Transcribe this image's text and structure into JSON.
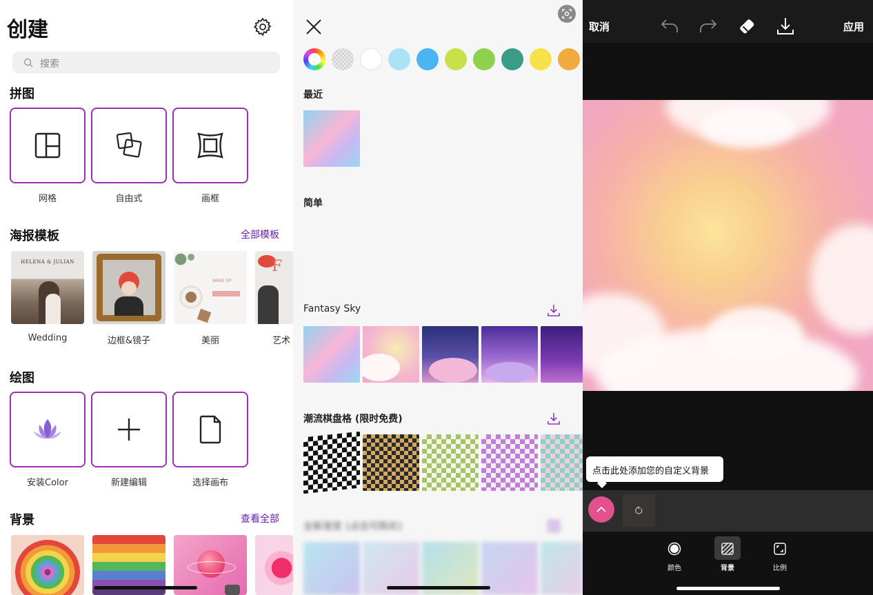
{
  "create": {
    "title": "创建",
    "search_placeholder": "搜索",
    "collage": {
      "heading": "拼图",
      "items": [
        {
          "label": "网格"
        },
        {
          "label": "自由式"
        },
        {
          "label": "画框"
        }
      ]
    },
    "poster": {
      "heading": "海报模板",
      "link": "全部模板",
      "items": [
        {
          "label": "Wedding"
        },
        {
          "label": "边框&镜子"
        },
        {
          "label": "美丽"
        },
        {
          "label": "艺术"
        }
      ],
      "wedding_caption": "HELENA & JULIAN",
      "beauty_caption": "WAKE UP"
    },
    "draw": {
      "heading": "绘图",
      "items": [
        {
          "label": "安装Color"
        },
        {
          "label": "新建编辑"
        },
        {
          "label": "选择画布"
        }
      ]
    },
    "background": {
      "heading": "背景",
      "link": "查看全部"
    }
  },
  "picker": {
    "colors": [
      "#ffffff",
      "#a9e3f5",
      "#4ab5f0",
      "#c8e04a",
      "#8ed14f",
      "#3a9c86",
      "#f7e14a",
      "#f0ab3c"
    ],
    "sections": [
      {
        "title": "最近"
      },
      {
        "title": "简单"
      },
      {
        "title": "Fantasy Sky"
      },
      {
        "title": "潮流棋盘格 (限时免费)"
      },
      {
        "title": "全新渐变 (点击可购买)"
      }
    ]
  },
  "editor": {
    "cancel": "取消",
    "apply": "应用",
    "tooltip": "点击此处添加您的自定义背景",
    "nav": [
      {
        "label": "颜色"
      },
      {
        "label": "背景"
      },
      {
        "label": "比例"
      }
    ]
  }
}
